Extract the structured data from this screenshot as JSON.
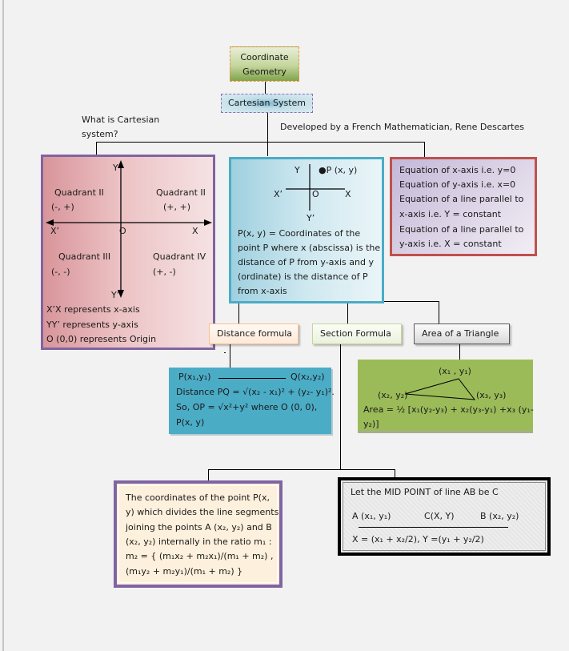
{
  "diagram_title": "Coordinate Geometry",
  "nodes": {
    "root": {
      "line1": "Coordinate",
      "line2": "Geometry"
    },
    "cartesian": {
      "label": "Cartesian System"
    },
    "question": {
      "line1": "What is Cartesian",
      "line2": "system?"
    },
    "developer_note": "Developed by a French Mathematician, Rene Descartes",
    "quadrants": {
      "y_label": "Y",
      "y_prime_label": "Y’",
      "x_label": "X",
      "x_prime_label": "X’",
      "origin_label": "O",
      "q2_name": "Quadrant II",
      "q2_signs": "(-, +)",
      "q1_name": "Quadrant II",
      "q1_signs": "(+, +)",
      "q3_name": "Quadrant III",
      "q3_signs": "(-, -)",
      "q4_name": "Quadrant IV",
      "q4_signs": "(+, -)",
      "notes": [
        "X’X represents x-axis",
        "YY’ represents y-axis",
        "O (0,0) represents Origin"
      ]
    },
    "point": {
      "y_label": "Y",
      "point_label": "●P (x, y)",
      "x_prime_label": "X’",
      "origin_label": "O",
      "x_label": "X",
      "y_prime_label": "Y’",
      "lines": [
        "P(x, y) = Coordinates of the",
        "point P where x (abscissa) is the",
        "distance of P from y-axis and y",
        "(ordinate) is the distance of P",
        "from x-axis"
      ]
    },
    "equations": {
      "lines": [
        "Equation of x-axis i.e. y=0",
        "Equation of y-axis i.e. x=0",
        "Equation of a line parallel to",
        "x-axis i.e. Y = constant",
        "Equation of a line parallel to",
        "y-axis i.e. X = constant"
      ]
    },
    "topics": {
      "distance": "Distance formula",
      "section": "Section Formula",
      "area": "Area of a Triangle"
    },
    "distance_box": {
      "p_label": "P(x₁,y₁)",
      "q_label": "Q(x₂,y₂)",
      "line1": "Distance  PQ = √(x₂ - x₁)² + (y₂- y₁)².",
      "line2": "So, OP = √x²+y²  where O (0, 0),",
      "line3": "P(x, y)"
    },
    "area_box": {
      "v1": "(x₁ , y₁)",
      "v2": "(x₂, y₂)",
      "v3": "(x₃,  y₃)",
      "line1": "Area = ½ [x₁(y₂-y₃) + x₂(y₃-y₁) +x₃ (y₁-",
      "line2": "y₂)]"
    },
    "section_box": {
      "lines": [
        "The coordinates of the point P(x,",
        "y) which divides the line segments",
        "joining the points A (x₂, y₂) and B",
        "(x₂, y₂) internally in the ratio m₁ :",
        "m₂ = { (m₁x₂ + m₂x₁)/(m₁ + m₂) ,",
        "(m₁y₂ + m₂y₁)/(m₁ + m₂) }"
      ]
    },
    "midpoint_box": {
      "title": "Let the MID POINT of line AB be C",
      "a_label": "A (x₁, y₁)",
      "c_label": "C(X, Y)",
      "b_label": "B (x₂, y₂)",
      "formula": "X = (x₁ + x₂/2),   Y =(y₁ + y₂/2)"
    }
  },
  "colors": {
    "background": "#f2f2f2",
    "purple_border": "#8064a2",
    "blue_border": "#4bacc6",
    "red_border": "#c0504d",
    "orange_dash": "#f0923c",
    "green_fill": "#9bbb59",
    "blue_fill": "#4bacc6"
  }
}
